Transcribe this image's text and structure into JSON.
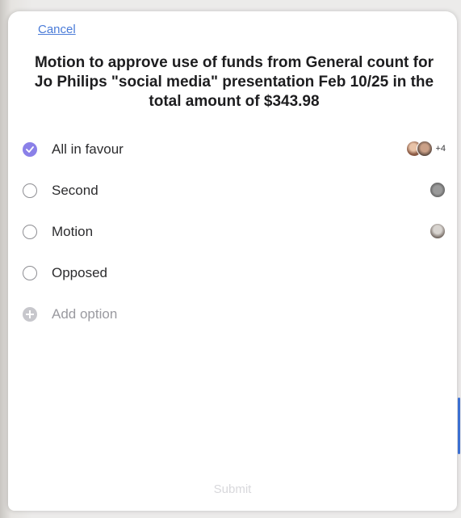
{
  "header": {
    "cancel_label": "Cancel"
  },
  "poll": {
    "question": "Motion to approve use of funds from General count for Jo Philips \"social media\" presentation Feb 10/25 in the total amount of $343.98",
    "options": [
      {
        "label": "All in favour",
        "selected": true,
        "voters_extra": "+4"
      },
      {
        "label": "Second",
        "selected": false
      },
      {
        "label": "Motion",
        "selected": false
      },
      {
        "label": "Opposed",
        "selected": false
      }
    ],
    "add_option_label": "Add option"
  },
  "footer": {
    "submit_label": "Submit"
  },
  "colors": {
    "accent": "#4a7bd8",
    "selected_radio": "#8a80e8"
  }
}
